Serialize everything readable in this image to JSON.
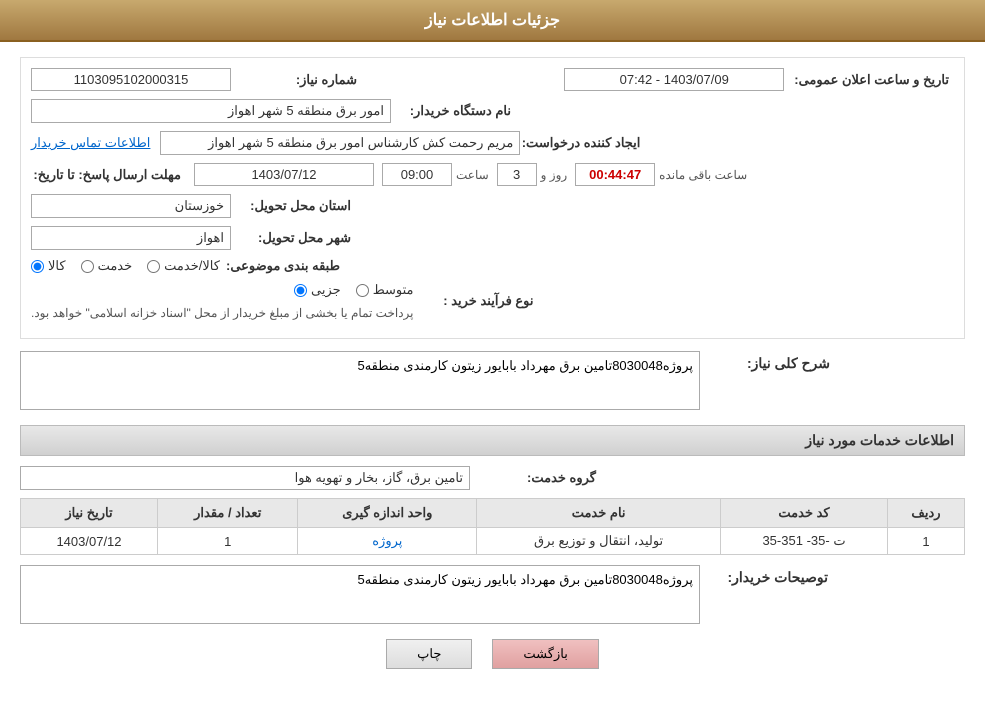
{
  "header": {
    "title": "جزئیات اطلاعات نیاز"
  },
  "fields": {
    "request_number_label": "شماره نیاز:",
    "request_number_value": "1103095102000315",
    "buyer_station_label": "نام دستگاه خریدار:",
    "buyer_station_value": "امور برق منطقه 5 شهر اهواز",
    "creator_label": "ایجاد کننده درخواست:",
    "creator_value": "مریم رحمت کش کارشناس امور برق منطقه 5 شهر اهواز",
    "contact_link": "اطلاعات تماس خریدار",
    "deadline_label": "مهلت ارسال پاسخ: تا تاریخ:",
    "deadline_date": "1403/07/12",
    "deadline_time_label": "ساعت",
    "deadline_time": "09:00",
    "deadline_days_label": "روز و",
    "deadline_days": "3",
    "deadline_remaining_label": "ساعت باقی مانده",
    "deadline_remaining": "00:44:47",
    "announce_label": "تاریخ و ساعت اعلان عمومی:",
    "announce_value": "1403/07/09 - 07:42",
    "province_label": "استان محل تحویل:",
    "province_value": "خوزستان",
    "city_label": "شهر محل تحویل:",
    "city_value": "اهواز",
    "category_label": "طبقه بندی موضوعی:",
    "category_options": [
      "کالا",
      "خدمت",
      "کالا/خدمت"
    ],
    "category_selected": "کالا",
    "process_label": "نوع فرآیند خرید :",
    "process_options": [
      "جزیی",
      "متوسط"
    ],
    "process_note": "پرداخت تمام یا بخشی از مبلغ خریدار از محل \"اسناد خزانه اسلامی\" خواهد بود.",
    "description_label": "شرح کلی نیاز:",
    "description_value": "پروژه8030048تامین برق مهرداد بابایور زیتون کارمندی منطقه5"
  },
  "service_info": {
    "section_title": "اطلاعات خدمات مورد نیاز",
    "group_label": "گروه خدمت:",
    "group_value": "تامین برق، گاز، بخار و تهویه هوا",
    "table": {
      "headers": [
        "ردیف",
        "کد خدمت",
        "نام خدمت",
        "واحد اندازه گیری",
        "تعداد / مقدار",
        "تاریخ نیاز"
      ],
      "rows": [
        {
          "row": "1",
          "code": "ت -35- 351-35",
          "name": "تولید، انتقال و توزیع برق",
          "unit": "پروژه",
          "count": "1",
          "date": "1403/07/12"
        }
      ]
    }
  },
  "buyer_notes": {
    "label": "توصیحات خریدار:",
    "value": "پروژه8030048تامین برق مهرداد بابایور زیتون کارمندی منطقه5"
  },
  "buttons": {
    "print": "چاپ",
    "back": "بازگشت"
  }
}
